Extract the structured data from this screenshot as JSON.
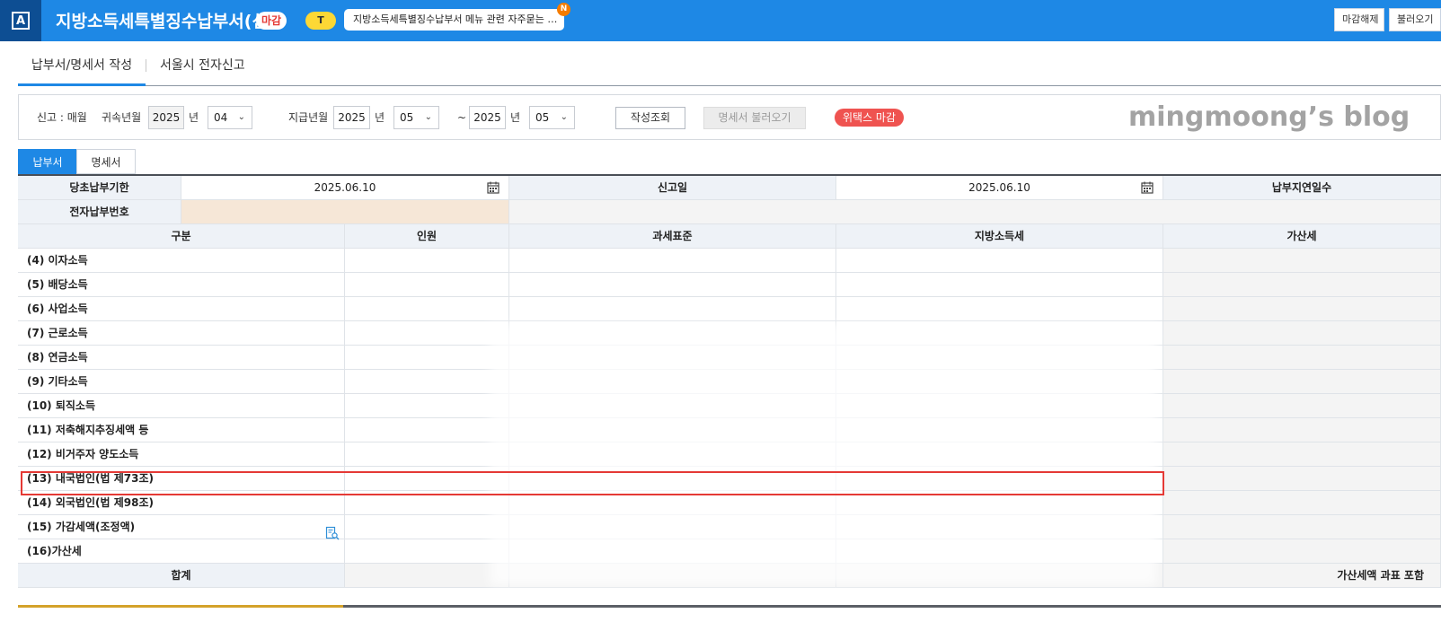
{
  "header": {
    "logo_letter": "A",
    "title": "지방소득세특별징수납부서(신)",
    "close_badge": "마감",
    "ti_badge": "T",
    "notice": "지방소득세특별징수납부서 메뉴 관련 자주묻는 …",
    "notice_badge": "N",
    "buttons": [
      "마감해제",
      "불러오기"
    ]
  },
  "main_tabs": [
    "납부서/명세서 작성",
    "서울시 전자신고"
  ],
  "filters": {
    "report_label": "신고 : 매월",
    "belong_label": "귀속년월",
    "belong_year": "2025",
    "year_unit": "년",
    "belong_month": "04",
    "pay_label": "지급년월",
    "pay_from_year": "2025",
    "pay_from_month": "05",
    "tilde": "~",
    "pay_to_year": "2025",
    "pay_to_month": "05",
    "query_button": "작성조회",
    "load_button": "명세서 불러오기",
    "wetax_badge": "위택스 마감",
    "watermark": "mingmoong’s blog"
  },
  "sub_tabs": [
    "납부서",
    "명세서"
  ],
  "table": {
    "row1": {
      "due_label": "당초납부기한",
      "due_value": "2025.06.10",
      "report_date_label": "신고일",
      "report_date_value": "2025.06.10",
      "delay_label": "납부지연일수"
    },
    "row2": {
      "epay_label": "전자납부번호"
    },
    "columns": [
      "구분",
      "인원",
      "과세표준",
      "지방소득세",
      "가산세"
    ],
    "rows": [
      "(4) 이자소득",
      "(5) 배당소득",
      "(6) 사업소득",
      "(7) 근로소득",
      "(8) 연금소득",
      "(9) 기타소득",
      "(10) 퇴직소득",
      "(11) 저축해지추징세액 등",
      "(12) 비거주자 양도소득",
      "(13) 내국법인(법 제73조)",
      "(14) 외국법인(법 제98조)",
      "(15) 가감세액(조정액)",
      "(16)가산세"
    ],
    "total_label": "합계",
    "total_note": "가산세액 과표 포함"
  },
  "colors": {
    "header_bg": "#1e88e5",
    "logo_bg": "#0d4e93",
    "highlight": "#e53935",
    "wetax": "#ef5350"
  }
}
